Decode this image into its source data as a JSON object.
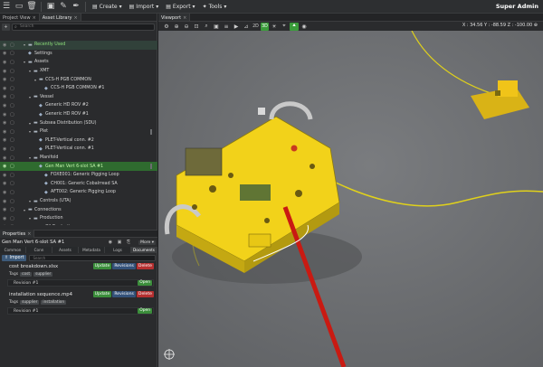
{
  "toolbar": {
    "menus": [
      "Create",
      "Import",
      "Export",
      "Tools"
    ],
    "user": "Super Admin"
  },
  "left_tabs": [
    "Project View",
    "Asset Library"
  ],
  "tree": {
    "search_placeholder": "Search",
    "rows": [
      {
        "label": "Recently Used",
        "indent": 1,
        "kind": "folder"
      },
      {
        "label": "Settings",
        "indent": 1,
        "kind": "asset"
      },
      {
        "label": "Assets",
        "indent": 1,
        "kind": "folder"
      },
      {
        "label": "XMT",
        "indent": 2,
        "kind": "folder"
      },
      {
        "label": "CCS-H PGB COMMON",
        "indent": 3,
        "kind": "folder"
      },
      {
        "label": "CCS-H PGB COMMON #1",
        "indent": 4,
        "kind": "asset"
      },
      {
        "label": "Vessel",
        "indent": 2,
        "kind": "folder"
      },
      {
        "label": "Generic HD ROV #2",
        "indent": 3,
        "kind": "asset"
      },
      {
        "label": "Generic HD ROV #1",
        "indent": 3,
        "kind": "asset"
      },
      {
        "label": "Subsea Distribution (SDU)",
        "indent": 2,
        "kind": "folder"
      },
      {
        "label": "Plet",
        "indent": 2,
        "kind": "folder"
      },
      {
        "label": "PLET-Vertical conn. #2",
        "indent": 3,
        "kind": "asset"
      },
      {
        "label": "PLET-Vertical conn. #1",
        "indent": 3,
        "kind": "asset"
      },
      {
        "label": "Manifold",
        "indent": 2,
        "kind": "folder"
      },
      {
        "label": "Gen Man Vert 6-slot SA #1",
        "indent": 3,
        "kind": "asset"
      },
      {
        "label": "FOXE001: Generic Pigging Loop",
        "indent": 4,
        "kind": "asset"
      },
      {
        "label": "CH001: Generic Cobalrread SA",
        "indent": 4,
        "kind": "asset"
      },
      {
        "label": "AFT002: Generic Pigging Loop",
        "indent": 4,
        "kind": "asset"
      },
      {
        "label": "Controls (UTA)",
        "indent": 2,
        "kind": "folder"
      },
      {
        "label": "Connections",
        "indent": 1,
        "kind": "folder"
      },
      {
        "label": "Production",
        "indent": 2,
        "kind": "folder"
      },
      {
        "label": "Oil Production",
        "indent": 3,
        "kind": "folder"
      },
      {
        "label": "Offloading Hose",
        "indent": 3,
        "kind": "folder"
      },
      {
        "label": "Power Cable",
        "indent": 2,
        "kind": "folder"
      }
    ]
  },
  "properties": {
    "header": "Properties",
    "title": "Gen Man Vert 6-slot SA #1",
    "more_label": "More",
    "tabs": [
      "Common",
      "Conn",
      "Assets",
      "Metadata",
      "Logs",
      "Documents"
    ],
    "import_label": "Import",
    "search_placeholder": "Search",
    "documents": [
      {
        "name": "cost breakdown.xlsx",
        "tags_label": "Tags",
        "tags": [
          "cost",
          "supplier"
        ],
        "revision": "Revision #1"
      },
      {
        "name": "installation sequence.mp4",
        "tags_label": "Tags",
        "tags": [
          "supplier",
          "installation"
        ],
        "revision": "Revision #1"
      }
    ],
    "buttons": {
      "update": "Update",
      "revisions": "Revisions",
      "delete": "Delete",
      "open": "Open"
    }
  },
  "viewport": {
    "tab": "Viewport",
    "buttons_2d": "2D",
    "buttons_3d": "3D",
    "coords": "X : 34.56   Y : -88.59   Z : -100.00   ⊕"
  },
  "colors": {
    "accent_green": "#3a9c3a",
    "selection_green": "#2f6b2f",
    "manifold_yellow": "#f2d21a",
    "seabed": "#6e7073"
  }
}
